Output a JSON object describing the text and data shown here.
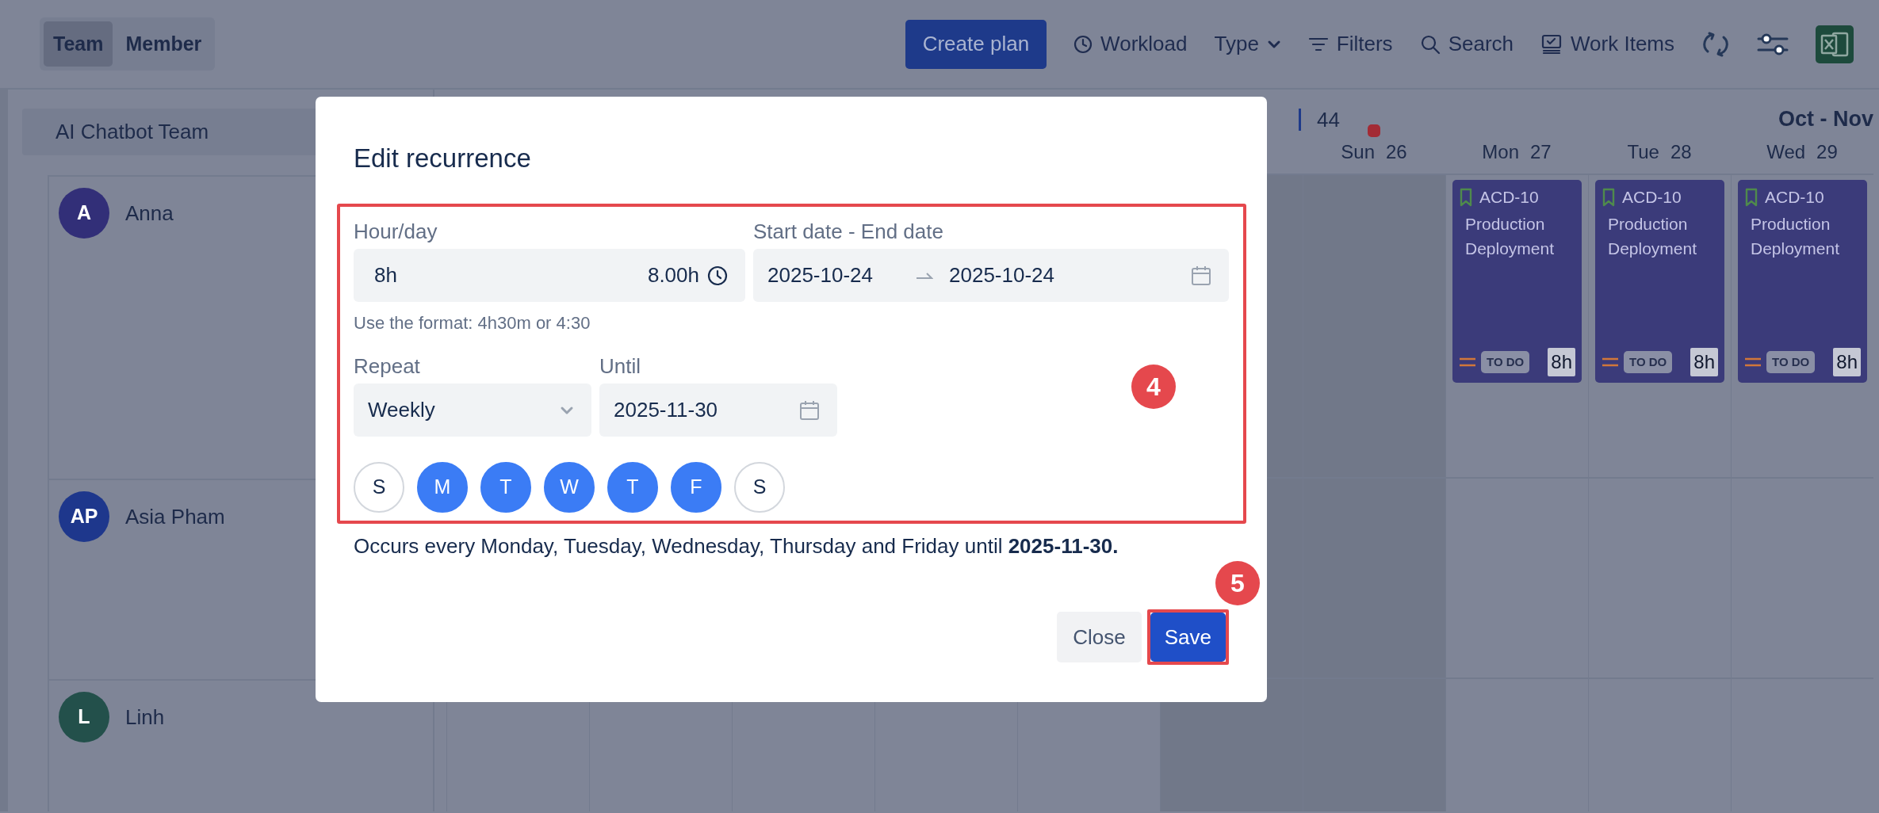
{
  "view_toggle": [
    {
      "label": "Team",
      "selected": true
    },
    {
      "label": "Member",
      "selected": false
    }
  ],
  "toolbar": {
    "create_button": "Create plan",
    "items": [
      {
        "label": "Workload",
        "kind": "clock"
      },
      {
        "label": "Type",
        "kind": "dropdown"
      },
      {
        "label": "Filters",
        "kind": "filter"
      },
      {
        "label": "Search",
        "kind": "search"
      },
      {
        "label": "Work Items",
        "kind": "monitor"
      }
    ]
  },
  "team": "AI Chatbot Team",
  "members": [
    {
      "initials": "A",
      "name": "Anna",
      "color": "#322f78"
    },
    {
      "initials": "AP",
      "name": "Asia Pham",
      "color": "#1e378c"
    },
    {
      "initials": "L",
      "name": "Linh",
      "color": "#23504b"
    }
  ],
  "calendar": {
    "week": "44",
    "month_range": "Oct - Nov",
    "covered_columns": [
      {
        "weekend": false
      },
      {
        "weekend": false
      },
      {
        "weekend": false
      },
      {
        "weekend": false
      },
      {
        "weekend": false
      },
      {
        "weekend": true
      }
    ],
    "days": [
      {
        "weekday": "Sun",
        "date": "26",
        "weekend": true,
        "today": true
      },
      {
        "weekday": "Mon",
        "date": "27",
        "weekend": false,
        "today": false,
        "tasks": [
          {
            "key": "ACD-10",
            "title": "Production Deployment",
            "status": "TO DO",
            "hours": "8h"
          }
        ]
      },
      {
        "weekday": "Tue",
        "date": "28",
        "weekend": false,
        "today": false,
        "tasks": [
          {
            "key": "ACD-10",
            "title": "Production Deployment",
            "status": "TO DO",
            "hours": "8h"
          }
        ]
      },
      {
        "weekday": "Wed",
        "date": "29",
        "weekend": false,
        "today": false,
        "tasks": [
          {
            "key": "ACD-10",
            "title": "Production Deployment",
            "status": "TO DO",
            "hours": "8h"
          }
        ]
      }
    ]
  },
  "modal": {
    "title": "Edit recurrence",
    "hour_label": "Hour/day",
    "hour_value": "8h",
    "hour_total": "8.00h",
    "hint": "Use the format: 4h30m or 4:30",
    "date_label": "Start date - End date",
    "start_date": "2025-10-24",
    "end_date": "2025-10-24",
    "repeat_label": "Repeat",
    "repeat_value": "Weekly",
    "until_label": "Until",
    "until_value": "2025-11-30",
    "weekdays": [
      {
        "label": "S",
        "selected": false
      },
      {
        "label": "M",
        "selected": true
      },
      {
        "label": "T",
        "selected": true
      },
      {
        "label": "W",
        "selected": true
      },
      {
        "label": "T",
        "selected": true
      },
      {
        "label": "F",
        "selected": true
      },
      {
        "label": "S",
        "selected": false
      }
    ],
    "summary": "Occurs every Monday, Tuesday, Wednesday, Thursday and Friday until **2025-11-30.**",
    "buttons": [
      {
        "label": "Close",
        "kind": "secondary",
        "highlighted": false
      },
      {
        "label": "Save",
        "kind": "primary",
        "highlighted": true
      }
    ]
  },
  "callouts": [
    {
      "label": "4"
    },
    {
      "label": "5"
    }
  ]
}
